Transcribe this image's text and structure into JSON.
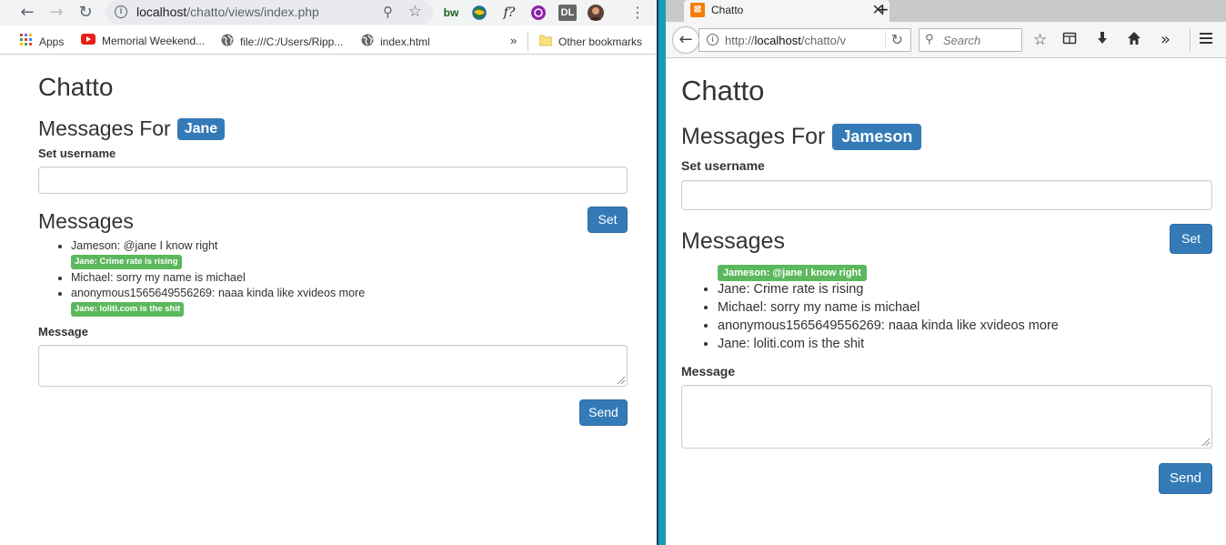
{
  "left": {
    "browser": {
      "url_host": "localhost",
      "url_path": "/chatto/views/index.php",
      "extensions": [
        "bw",
        "f?",
        "DL"
      ],
      "bookmarks": [
        {
          "label": "Apps",
          "icon": "apps-grid-icon"
        },
        {
          "label": "Memorial Weekend...",
          "icon": "youtube-icon"
        },
        {
          "label": "file:///C:/Users/Ripp...",
          "icon": "globe-icon"
        },
        {
          "label": "index.html",
          "icon": "globe-icon"
        }
      ],
      "overflow": "»",
      "other_bookmarks": "Other bookmarks"
    },
    "page": {
      "brand": "Chatto",
      "messages_for": "Messages For",
      "username": "Jane",
      "set_username_label": "Set username",
      "set_username_value": "",
      "set_button": "Set",
      "messages_title": "Messages",
      "messages": [
        {
          "text": "Jameson: @jane I know right",
          "type": "plain"
        },
        {
          "text": "Jane: Crime rate is rising",
          "type": "label"
        },
        {
          "text": "Michael: sorry my name is michael",
          "type": "plain"
        },
        {
          "text": "anonymous1565649556269: naaa kinda like xvideos more",
          "type": "plain"
        },
        {
          "text": "Jane: loliti.com is the shit",
          "type": "label"
        }
      ],
      "message_label": "Message",
      "message_value": "",
      "send_button": "Send"
    }
  },
  "right": {
    "browser": {
      "tab_title": "Chatto",
      "url_prefix": "http://",
      "url_host": "localhost",
      "url_path": "/chatto/v",
      "search_placeholder": "Search"
    },
    "page": {
      "brand": "Chatto",
      "messages_for": "Messages For",
      "username": "Jameson",
      "set_username_label": "Set username",
      "set_username_value": "",
      "set_button": "Set",
      "messages_title": "Messages",
      "highlight_message": "Jameson: @jane I know right",
      "messages": [
        "Jane: Crime rate is rising",
        "Michael: sorry my name is michael",
        "anonymous1565649556269: naaa kinda like xvideos more",
        "Jane: loliti.com is the shit"
      ],
      "message_label": "Message",
      "message_value": "",
      "send_button": "Send"
    }
  },
  "colors": {
    "desktop": "#1a9bb5",
    "primary": "#337ab7",
    "success": "#5cb85c"
  }
}
